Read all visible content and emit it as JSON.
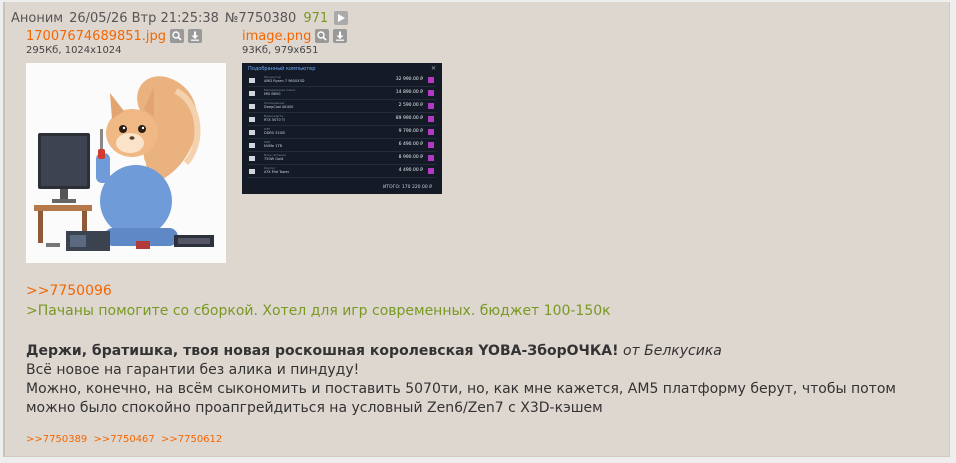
{
  "post": {
    "name": "Аноним",
    "date": "26/05/26 Втр 21:25:38",
    "number": "№7750380",
    "count": "971"
  },
  "files": [
    {
      "name": "17007674689851.jpg",
      "meta": "295Кб, 1024x1024"
    },
    {
      "name": "image.png",
      "meta": "93Кб, 979x651"
    }
  ],
  "pc_build": {
    "title": "Подобранный компьютер",
    "rows": [
      {
        "cat": "Процессор",
        "product": "AMD Ryzen 7 9800X3D",
        "price": "32 990.00 ₽"
      },
      {
        "cat": "Материнская плата",
        "product": "MSI B650",
        "price": "14 890.00 ₽"
      },
      {
        "cat": "Охлаждение",
        "product": "DeepCool AK400",
        "price": "2 590.00 ₽"
      },
      {
        "cat": "Видеокарта",
        "product": "RTX 5070 Ti",
        "price": "89 990.00 ₽"
      },
      {
        "cat": "ОЗУ",
        "product": "DDR5 32GB",
        "price": "9 790.00 ₽"
      },
      {
        "cat": "SSD",
        "product": "NVMe 1TB",
        "price": "6 490.00 ₽"
      },
      {
        "cat": "Блок питания",
        "product": "750W Gold",
        "price": "8 990.00 ₽"
      },
      {
        "cat": "Корпус",
        "product": "ATX Mid Tower",
        "price": "4 490.00 ₽"
      }
    ],
    "total": "ИТОГО: 170 220.00 ₽"
  },
  "reply_to": ">>7750096",
  "quote": ">Пачаны помогите со сборкой. Хотел для игр современных. бюджет 100-150к",
  "body": {
    "bold": "Держи, братишка, твоя новая роскошная королевская YOBA-ЗборОЧКА!",
    "italic": "от Белкусика",
    "line2": "Всё новое на гарантии без алика и пиндуду!",
    "line3": "Можно, конечно, на всём сыкономить и поставить 5070ти, но, как мне кажется, АМ5 платформу берут, чтобы потом можно было спокойно проапгрейдиться на условный Zen6/Zen7 с X3D-кэшем"
  },
  "replies": [
    ">>7750389",
    ">>7750467",
    ">>7750612"
  ],
  "colors": {
    "link": "#f56600",
    "quote": "#789922",
    "background": "#ded7d0"
  }
}
